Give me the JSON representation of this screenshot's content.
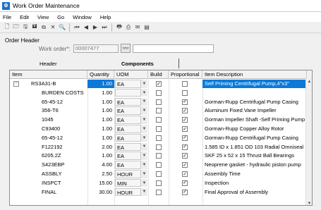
{
  "window": {
    "title": "Work Order Maintenance",
    "icon": "app-icon"
  },
  "menu": [
    "File",
    "Edit",
    "View",
    "Go",
    "Window",
    "Help"
  ],
  "toolbar": {
    "icons": [
      "new-icon",
      "open-icon",
      "save-icon",
      "save-all-icon",
      "copy-icon",
      "delete-icon",
      "find-icon",
      "first-icon",
      "previous-icon",
      "next-icon",
      "last-icon",
      "print-icon",
      "print-preview-icon",
      "email-icon",
      "properties-icon"
    ]
  },
  "order_header": {
    "label": "Order Header",
    "work_order_label": "Work order*:",
    "work_order_value": "00007477",
    "description_value": ""
  },
  "tabs": {
    "header": "Header",
    "components": "Components"
  },
  "grid": {
    "columns": [
      "Item",
      "Quantity",
      "UOM",
      "Build",
      "Proportional",
      "Item Description"
    ],
    "rows": [
      {
        "item": "RS3A31-B",
        "qty": "1.00",
        "uom": "EA",
        "build": true,
        "proportional": false,
        "desc": "Self Priming Centrifugal Pump,4\"x3\"",
        "selected": true,
        "root": true
      },
      {
        "item": "BURDEN COSTS",
        "qty": "1.00",
        "uom": "",
        "build": false,
        "proportional": false,
        "desc": ""
      },
      {
        "item": "65-45-12",
        "qty": "1.00",
        "uom": "EA",
        "build": false,
        "proportional": true,
        "desc": "Gorman-Rupp Centrifugal Pump Casing"
      },
      {
        "item": "356-T6",
        "qty": "1.00",
        "uom": "EA",
        "build": false,
        "proportional": true,
        "desc": "Aluminum Fixed Vane Impeller"
      },
      {
        "item": "1045",
        "qty": "1.00",
        "uom": "EA",
        "build": false,
        "proportional": true,
        "desc": "Gorman Impeller Shaft -Self Priming Pump"
      },
      {
        "item": "C93400",
        "qty": "1.00",
        "uom": "EA",
        "build": false,
        "proportional": true,
        "desc": "Gorman-Rupp Copper Alloy Rotor"
      },
      {
        "item": "65-45-12",
        "qty": "1.00",
        "uom": "EA",
        "build": false,
        "proportional": true,
        "desc": "Gorman-Rupp Centrifugal Pump Casing"
      },
      {
        "item": "F122192",
        "qty": "2.00",
        "uom": "EA",
        "build": false,
        "proportional": true,
        "desc": "1.585 ID x 1.851 OD 103 Radial Omniseal"
      },
      {
        "item": "6205.2Z",
        "qty": "1.00",
        "uom": "EA",
        "build": false,
        "proportional": true,
        "desc": "SKF 25 x 52 x 15 Thrust Ball Bearings"
      },
      {
        "item": "S423EBP",
        "qty": "4.00",
        "uom": "EA",
        "build": false,
        "proportional": true,
        "desc": "Neoprene gasket - hydraulic piston pump"
      },
      {
        "item": "ASSBLY",
        "qty": "2.50",
        "uom": "HOUR",
        "build": false,
        "proportional": true,
        "desc": "Assembly Time"
      },
      {
        "item": "INSPCT",
        "qty": "15.00",
        "uom": "MIN",
        "build": false,
        "proportional": true,
        "desc": "Inspection"
      },
      {
        "item": "FINAL",
        "qty": "30.00",
        "uom": "HOUR",
        "build": false,
        "proportional": true,
        "desc": "Final Approval of Assembly"
      }
    ]
  },
  "colors": {
    "selection": "#0a79d8",
    "accent": "#1f6fc7"
  }
}
